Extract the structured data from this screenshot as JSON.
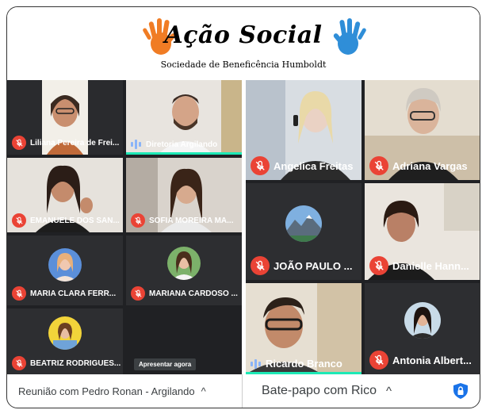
{
  "header": {
    "brand": "Ação Social",
    "subtitle": "Sociedade de Beneficência Humboldt"
  },
  "left_meeting": {
    "participants": [
      {
        "name": "Liliana Pereira de Frei...",
        "muted": true
      },
      {
        "name": "Diretoria Argilando",
        "muted": false
      },
      {
        "name": "EMANUELE DOS SAN...",
        "muted": true
      },
      {
        "name": "SOFIA MOREIRA MA...",
        "muted": true
      },
      {
        "name": "MARIA CLARA FERR...",
        "muted": true
      },
      {
        "name": "MARIANA CARDOSO ...",
        "muted": true
      },
      {
        "name": "BEATRIZ RODRIGUES...",
        "muted": true
      }
    ],
    "present_label": "Apresentar agora",
    "bottom_title": "Reunião com Pedro Ronan - Argilando",
    "caret": "^"
  },
  "right_meeting": {
    "participants": [
      {
        "name": "Angelica Freitas",
        "muted": true
      },
      {
        "name": "Adriana Vargas",
        "muted": true
      },
      {
        "name": "JOÃO PAULO ...",
        "muted": true
      },
      {
        "name": "Danielle Hann...",
        "muted": true
      },
      {
        "name": "Ricardo Branco",
        "muted": false
      },
      {
        "name": "Antonia Albert...",
        "muted": true
      }
    ],
    "bottom_title": "Bate-papo com Rico",
    "caret": "^"
  },
  "colors": {
    "muted_red": "#ea4335",
    "speaking_teal": "#1de9b6",
    "tile_bg": "#3c4043",
    "grid_bg": "#202124",
    "lock_blue": "#1a73e8"
  },
  "icons": [
    "left-hand-icon",
    "right-hand-icon",
    "mic-off-icon",
    "audio-level-icon",
    "lock-icon",
    "chevron-up-icon"
  ]
}
